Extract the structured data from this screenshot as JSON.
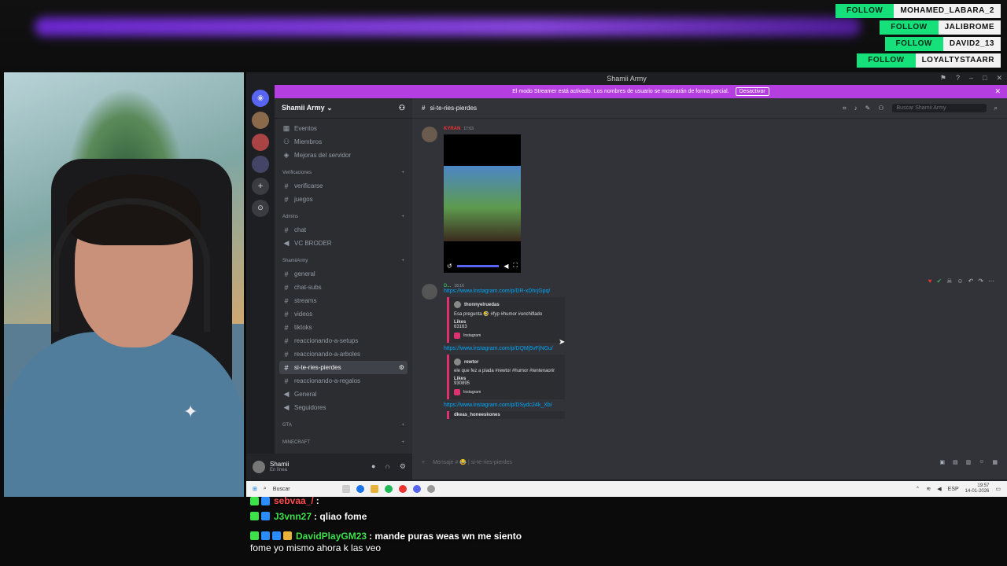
{
  "follows": [
    {
      "label": "FOLLOW",
      "user": "MOHAMED_LABARA_2"
    },
    {
      "label": "FOLLOW",
      "user": "JALIBROME"
    },
    {
      "label": "FOLLOW",
      "user": "DAVID2_13"
    },
    {
      "label": "FOLLOW",
      "user": "LOYALTYSTAARR"
    }
  ],
  "window": {
    "title": "Shamii Army"
  },
  "streamer_banner": {
    "text": "El modo Streamer está activado. Los nombres de usuario se mostrarán de forma parcial.",
    "button": "Desactivar"
  },
  "server": {
    "name": "Shamii Army ⌄"
  },
  "channels": {
    "top": [
      {
        "label": "Eventos",
        "icon": "calendar-icon"
      },
      {
        "label": "Miembros",
        "icon": "members-icon"
      },
      {
        "label": "Mejoras del servidor",
        "icon": "boost-icon"
      }
    ],
    "categories": [
      {
        "name": "Verificaciones",
        "items": [
          "verificarse",
          "juegos"
        ]
      },
      {
        "name": "Admins",
        "items": [
          "chat",
          "VC BRODER"
        ]
      },
      {
        "name": "ShamiiArmy",
        "items": [
          "general",
          "chat-subs",
          "streams",
          "videos",
          "tiktoks",
          "reaccionando-a-setups",
          "reaccionando-a-arboles",
          "si-te-ries-pierdes",
          "reaccionando-a-regalos",
          "General",
          "Seguidores"
        ]
      },
      {
        "name": "GTA",
        "items": []
      },
      {
        "name": "MINECRAFT",
        "items": []
      }
    ]
  },
  "user": {
    "name": "Shamii",
    "status": "En línea"
  },
  "chat": {
    "channel": "si-te-ries-pierdes",
    "search_placeholder": "Buscar Shamii Army",
    "msg1": {
      "author": "KYRAN",
      "time": "17:03"
    },
    "msg2": {
      "author": "D...",
      "time": "18:16",
      "link1": "https://www.instagram.com/p/DR-xDhrjGpq/",
      "embed1": {
        "author": "thonnyelruedas",
        "desc": "Esa pregunta 🤣 #fyp #humor #unchiflado",
        "likes_label": "Likes",
        "likes": "63163",
        "source": "Instagram"
      },
      "link2": "https://www.instagram.com/p/DQMj5vFjNGu/",
      "embed2": {
        "author": "rewtor",
        "desc": "ele que fez a piada #rewtor #humor #tentenaorir",
        "likes_label": "Likes",
        "likes": "930895",
        "source": "Instagram"
      },
      "link3": "https://www.instagram.com/p/DSydc24k_Xb/",
      "embed3": {
        "author": "dkeas_honeeskones"
      }
    },
    "composer_placeholder": "Mensaje # 😂 | si-te-ries-pierdes"
  },
  "taskbar": {
    "search": "Buscar",
    "lang": "ESP",
    "time": "19:57",
    "date": "14-01-2026"
  },
  "overlay_chat": [
    {
      "user": "sebvaa_/",
      "text": ":",
      "color": "#ff4d4d"
    },
    {
      "user": "J3vnn27",
      "text": ": qliao fome",
      "color": "#3de24b"
    },
    {
      "user": "DavidPlayGM23",
      "text": ": mande puras weas wn me siento",
      "color": "#3de24b",
      "cont": "fome yo mismo ahora k las veo"
    }
  ]
}
